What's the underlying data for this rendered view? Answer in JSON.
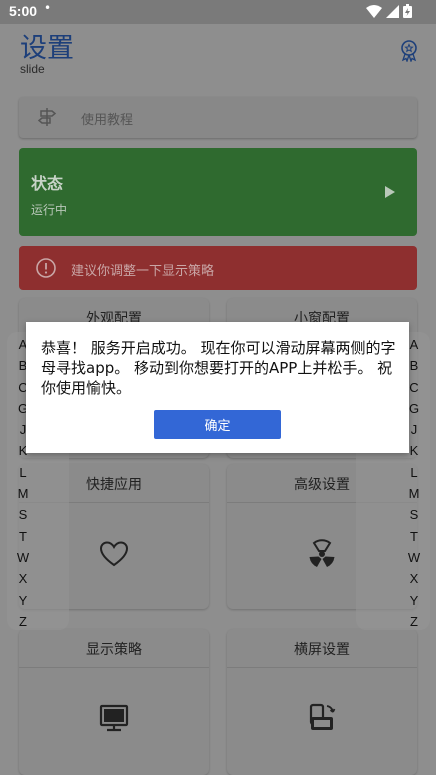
{
  "status_bar": {
    "time": "5:00",
    "dot": "•"
  },
  "header": {
    "title": "设置",
    "subtitle": "slide"
  },
  "tutorial": {
    "label": "使用教程"
  },
  "status_card": {
    "title": "状态",
    "state": "运行中"
  },
  "warning": {
    "text": "建议你调整一下显示策略"
  },
  "tiles": [
    {
      "label": "外观配置"
    },
    {
      "label": "小窗配置"
    },
    {
      "label": "快捷应用"
    },
    {
      "label": "高级设置"
    },
    {
      "label": "显示策略"
    },
    {
      "label": "横屏设置"
    }
  ],
  "index_letters": [
    "A",
    "B",
    "C",
    "G",
    "J",
    "K",
    "L",
    "M",
    "S",
    "T",
    "W",
    "X",
    "Y",
    "Z"
  ],
  "dialog": {
    "message": "恭喜！ 服务开启成功。 现在你可以滑动屏幕两侧的字母寻找app。 移动到你想要打开的APP上并松手。 祝你使用愉快。",
    "confirm_label": "确定"
  },
  "colors": {
    "title": "#1d3f7a",
    "status_green": "#2f6a2f",
    "warning_red": "#8e2f2f",
    "confirm_blue": "#3367d6"
  }
}
